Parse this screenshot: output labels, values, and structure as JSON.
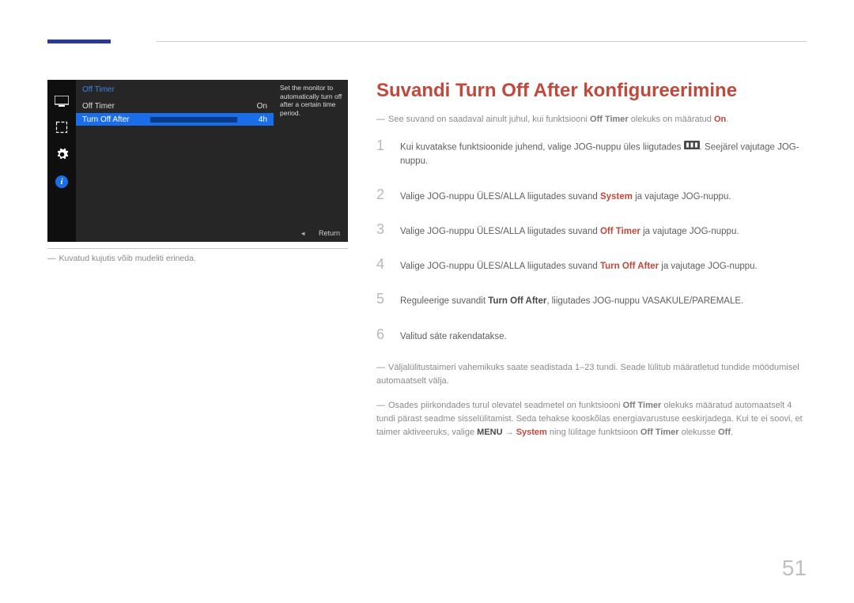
{
  "pagenum": "51",
  "title": "Suvandi Turn Off After konfigureerimine",
  "caption": "Kuvatud kujutis võib mudeliti erineda.",
  "shot": {
    "header": "Off Timer",
    "row1": {
      "label": "Off Timer",
      "value": "On"
    },
    "row2": {
      "label": "Turn Off After",
      "value": "4h"
    },
    "tip": "Set the monitor to automatically turn off after a certain time period.",
    "return": "Return"
  },
  "intro": {
    "pre": "See suvand on saadaval ainult juhul, kui funktsiooni ",
    "key1": "Off Timer",
    "mid": " olekuks on määratud ",
    "key2": "On",
    "post": "."
  },
  "steps": [
    {
      "n": "1",
      "pre": "Kui kuvatakse funktsioonide juhend, valige JOG-nuppu üles liigutades ",
      "post": ". Seejärel vajutage JOG-nuppu."
    },
    {
      "n": "2",
      "pre": "Valige JOG-nuppu ÜLES/ALLA liigutades suvand ",
      "k": "System",
      "post": " ja vajutage JOG-nuppu."
    },
    {
      "n": "3",
      "pre": "Valige JOG-nuppu ÜLES/ALLA liigutades suvand ",
      "k": "Off Timer",
      "post": " ja vajutage JOG-nuppu."
    },
    {
      "n": "4",
      "pre": "Valige JOG-nuppu ÜLES/ALLA liigutades suvand ",
      "k": "Turn Off After",
      "post": " ja vajutage JOG-nuppu."
    },
    {
      "n": "5",
      "pre": "Reguleerige suvandit ",
      "k": "Turn Off After",
      "post": ", liigutades JOG-nuppu VASAKULE/PAREMALE."
    },
    {
      "n": "6",
      "pre": "Valitud säte rakendatakse."
    }
  ],
  "foot1": "Väljalülitustaimeri vahemikuks saate seadistada 1–23 tundi. Seade lülitub määratletud tundide möödumisel automaatselt välja.",
  "foot2": {
    "a": "Osades piirkondades turul olevatel seadmetel on funktsiooni ",
    "b": "Off Timer",
    "c": " olekuks määratud automaatselt 4 tundi pärast seadme sisselülitamist. Seda tehakse kooskõlas energiavarustuse eeskirjadega. Kui te ei soovi, et taimer aktiveeruks, valige ",
    "d": "MENU",
    "arrow": " → ",
    "e": "System",
    "f": " ning lülitage funktsioon ",
    "g": "Off Timer",
    "h": " olekusse ",
    "i": "Off",
    "j": "."
  }
}
